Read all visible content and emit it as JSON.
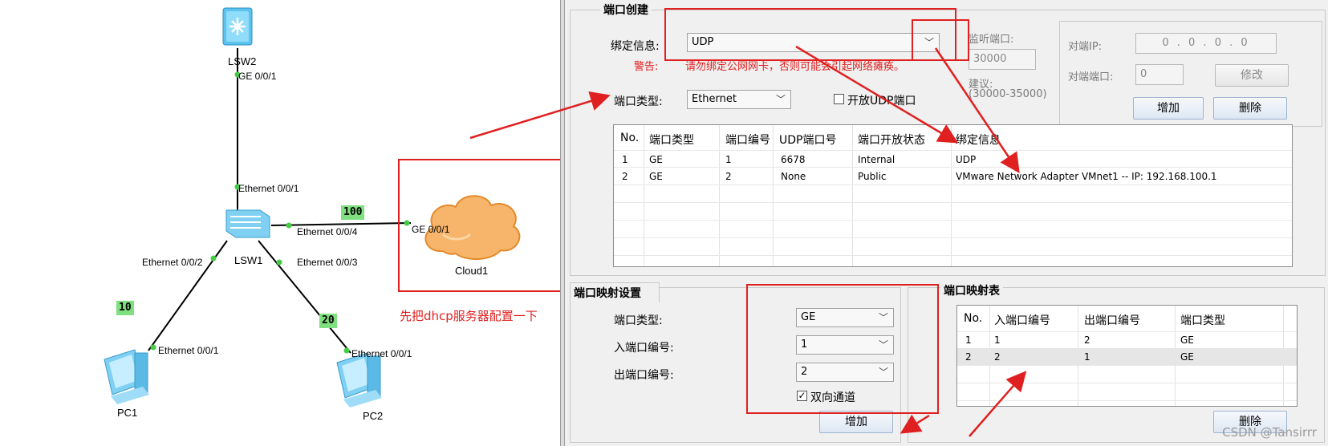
{
  "topology": {
    "devices": {
      "lsw2": "LSW2",
      "lsw1": "LSW1",
      "cloud1": "Cloud1",
      "pc1": "PC1",
      "pc2": "PC2"
    },
    "ports": {
      "lsw2_ge": "GE 0/0/1",
      "lsw1_e1": "Ethernet 0/0/1",
      "lsw1_e4": "Ethernet 0/0/4",
      "lsw1_e2": "Ethernet 0/0/2",
      "lsw1_e3": "Ethernet 0/0/3",
      "cloud_ge": "GE 0/0/1",
      "pc1_e": "Ethernet 0/0/1",
      "pc2_e": "Ethernet 0/0/1"
    },
    "vlans": {
      "v100": "100",
      "v10": "10",
      "v20": "20"
    },
    "note": "先把dhcp服务器配置一下"
  },
  "port_create": {
    "title": "端口创建",
    "bind_label": "绑定信息:",
    "bind_value": "UDP",
    "warning_label": "警告:",
    "warning_text": "请勿绑定公网网卡，否则可能会引起网络瘫痪。",
    "port_type_label": "端口类型:",
    "port_type_value": "Ethernet",
    "open_udp_label": "开放UDP端口",
    "listen_port_label": "监听端口:",
    "listen_port_value": "30000",
    "suggest_label": "建议:",
    "suggest_range": "(30000-35000)",
    "peer_ip_label": "对端IP:",
    "peer_ip_value": "0 . 0 . 0 . 0",
    "peer_port_label": "对端端口:",
    "peer_port_value": "0",
    "modify_button": "修改",
    "add_button": "增加",
    "delete_button": "删除",
    "table": {
      "headers": [
        "No.",
        "端口类型",
        "端口编号",
        "UDP端口号",
        "端口开放状态",
        "绑定信息"
      ],
      "rows": [
        [
          "1",
          "GE",
          "1",
          "6678",
          "Internal",
          "UDP"
        ],
        [
          "2",
          "GE",
          "2",
          "None",
          "Public",
          "VMware Network Adapter VMnet1 -- IP: 192.168.100.1"
        ]
      ]
    }
  },
  "port_map": {
    "title": "端口映射设置",
    "port_type_label": "端口类型:",
    "port_type_value": "GE",
    "in_port_label": "入端口编号:",
    "in_port_value": "1",
    "out_port_label": "出端口编号:",
    "out_port_value": "2",
    "bidirectional_label": "双向通道",
    "add_button": "增加"
  },
  "map_table": {
    "title": "端口映射表",
    "headers": [
      "No.",
      "入端口编号",
      "出端口编号",
      "端口类型"
    ],
    "rows": [
      [
        "1",
        "1",
        "2",
        "GE"
      ],
      [
        "2",
        "2",
        "1",
        "GE"
      ]
    ],
    "delete_button": "删除"
  },
  "watermark": "CSDN @Tansirrr",
  "colors": {
    "annotation_red": "#e02020",
    "vlan_green": "#7fe07f",
    "link_green": "#44cc44"
  }
}
